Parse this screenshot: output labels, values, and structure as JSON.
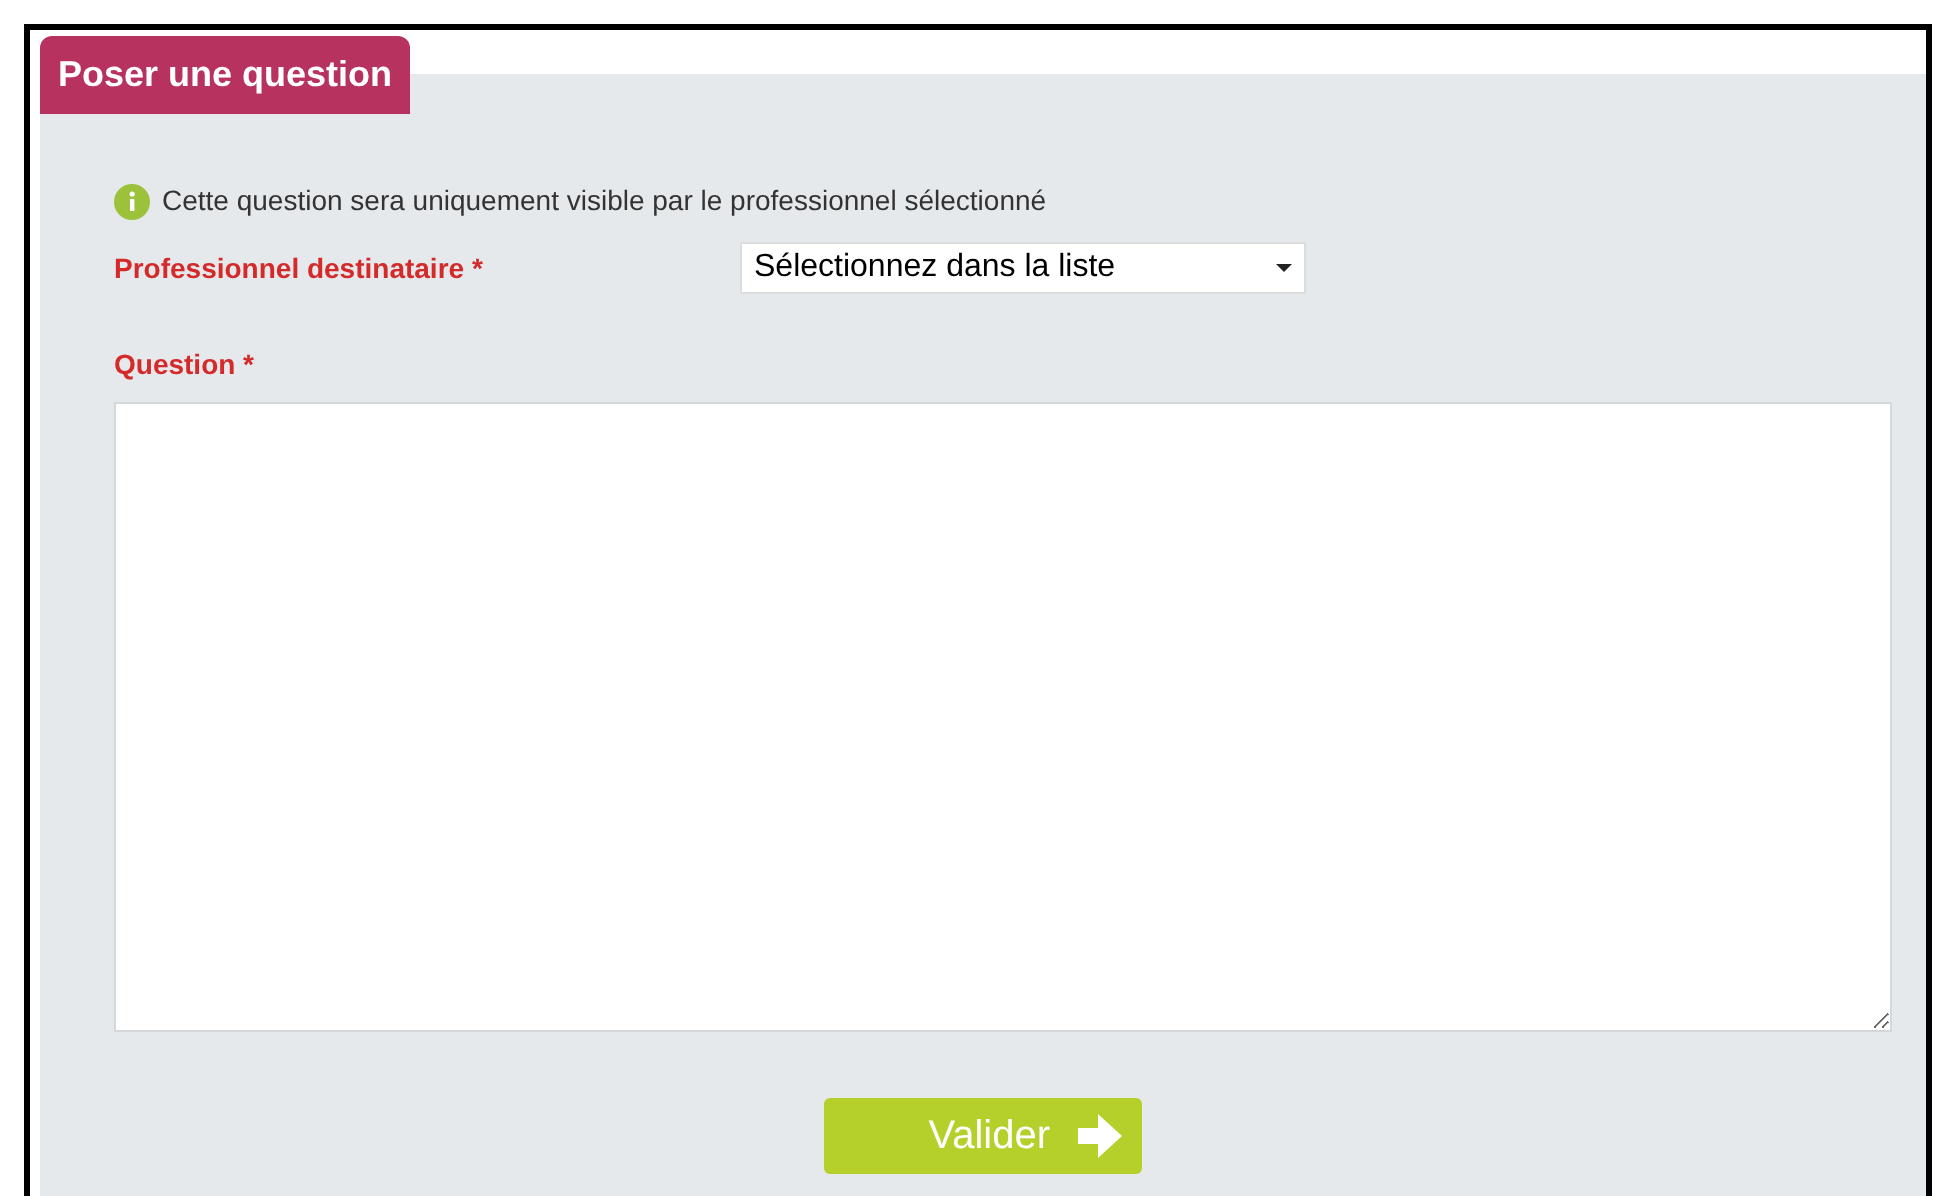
{
  "tab": {
    "title": "Poser une question"
  },
  "info": "Cette question sera uniquement visible par le professionnel sélectionné",
  "recipient": {
    "label": "Professionnel destinataire *",
    "value": "Sélectionnez dans la liste"
  },
  "question": {
    "label": "Question *"
  },
  "submit": "Valider"
}
